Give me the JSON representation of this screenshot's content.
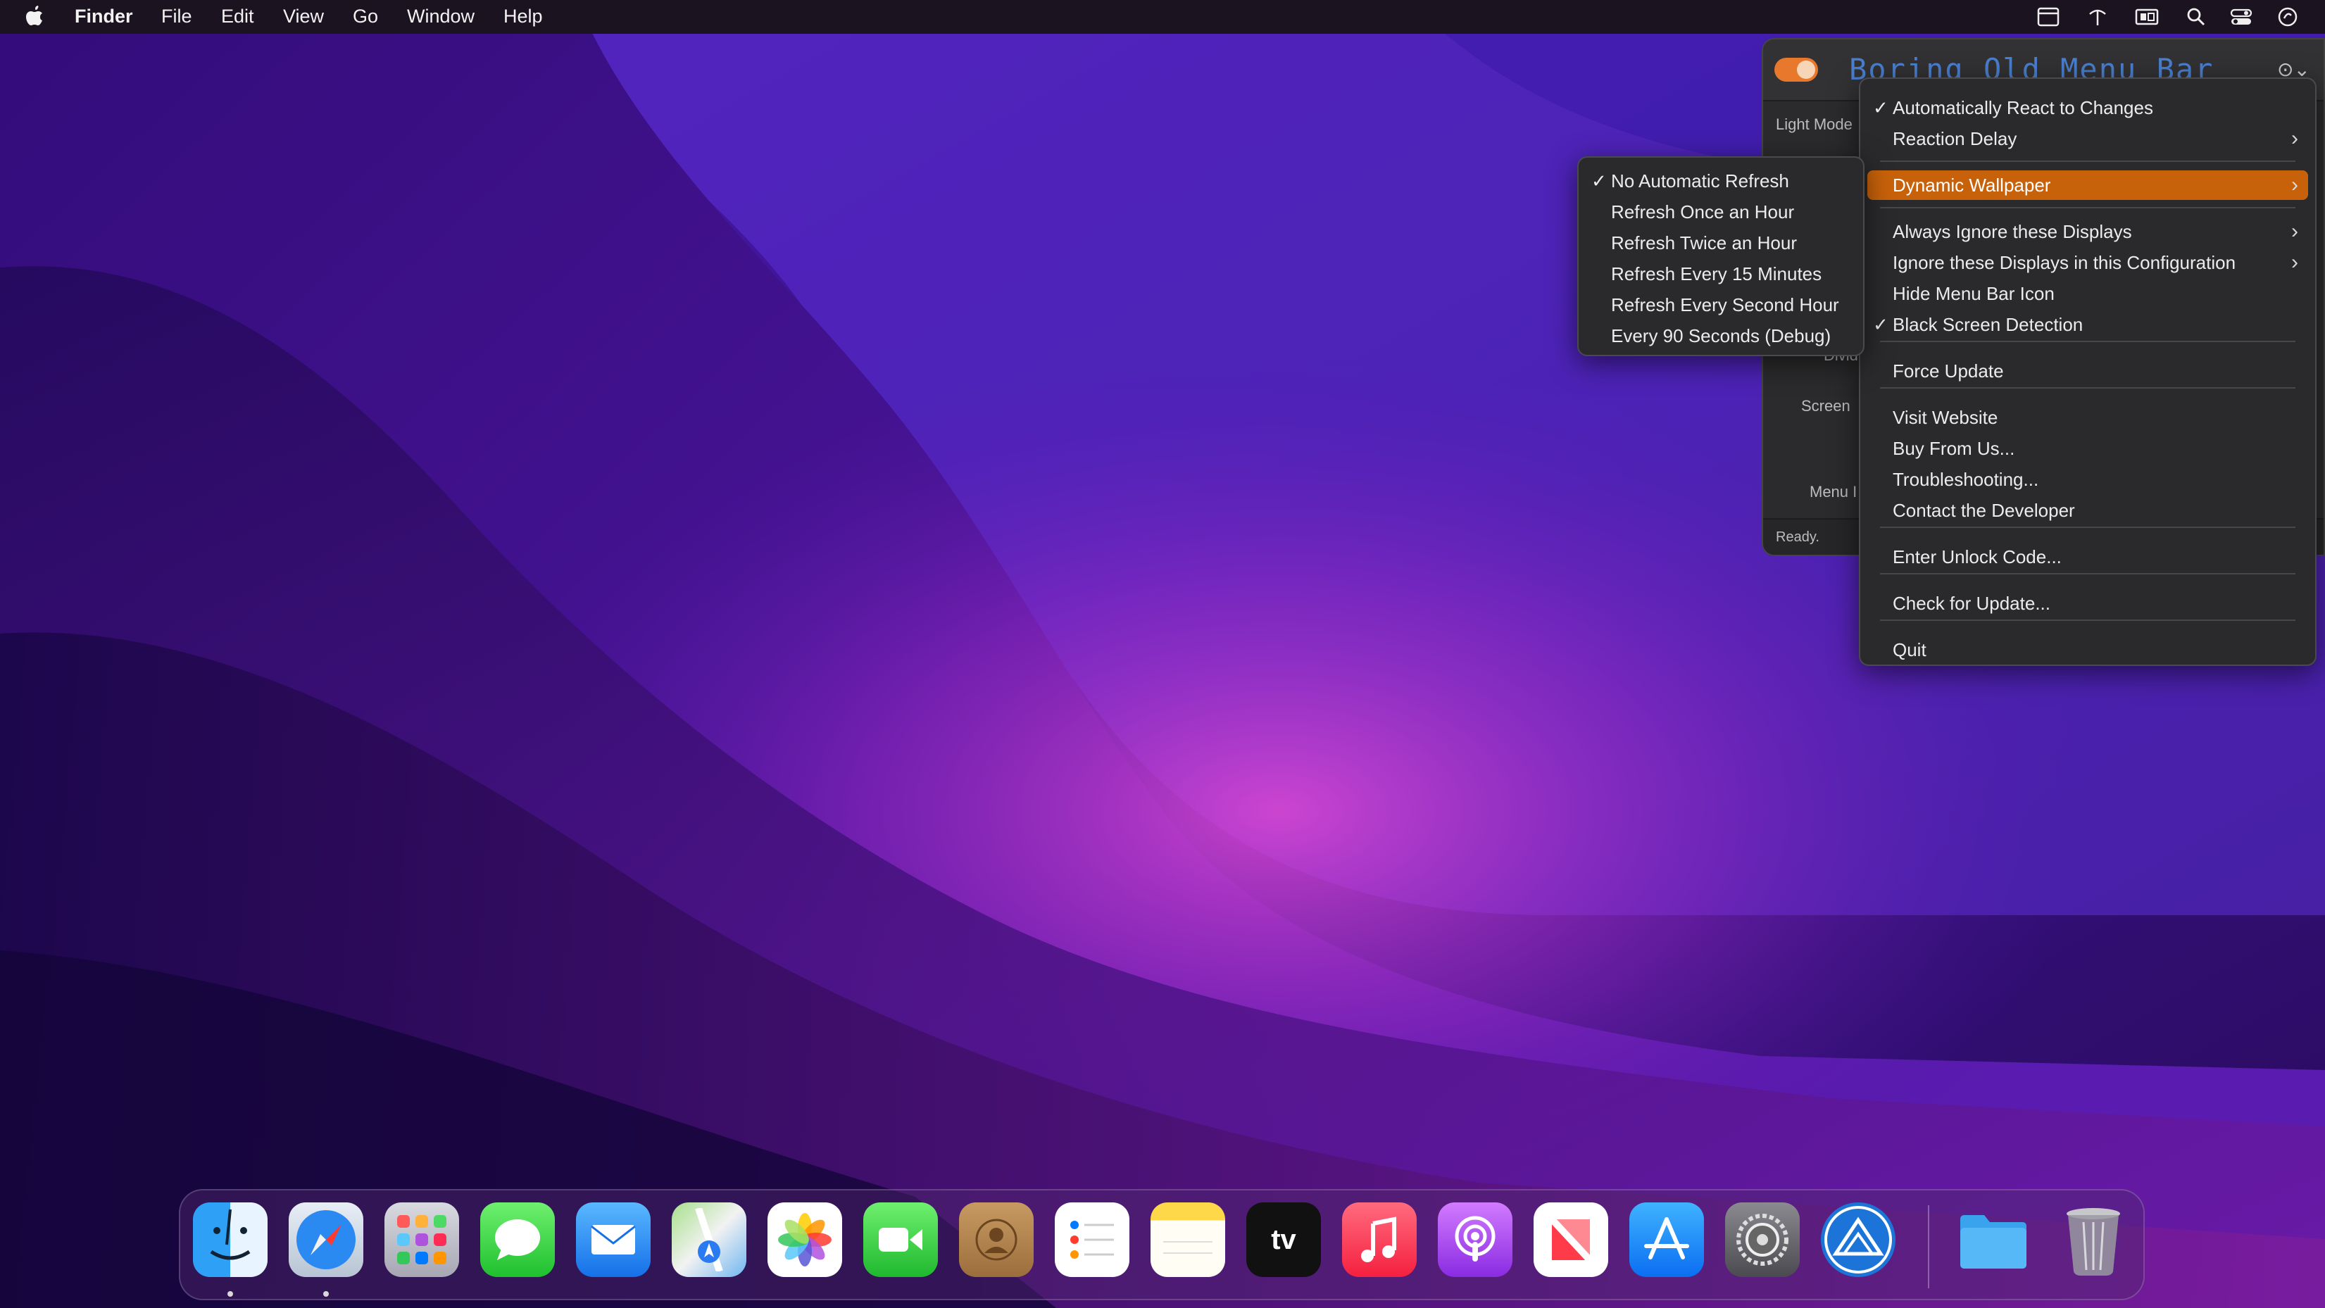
{
  "menubar": {
    "apple_icon": "apple-logo-icon",
    "app_name": "Finder",
    "menus": [
      "File",
      "Edit",
      "View",
      "Go",
      "Window",
      "Help"
    ],
    "status_icons": [
      "calendar-icon",
      "network-icon",
      "display-icon",
      "search-icon",
      "control-center-icon",
      "app-status-icon"
    ]
  },
  "app_window": {
    "title": "Boring Old Menu Bar",
    "labels": {
      "mode": "Light Mode",
      "divider": "Divid",
      "screen": "Screen",
      "menu": "Menu I"
    },
    "status": "Ready.",
    "toggle_on": true,
    "accent_color": "#e8792c"
  },
  "main_menu": {
    "items": [
      {
        "label": "Automatically React to Changes",
        "checked": true
      },
      {
        "label": "Reaction Delay",
        "submenu": true
      },
      {
        "label": "Dynamic Wallpaper",
        "submenu": true,
        "highlighted": true
      },
      {
        "label": "Always Ignore these Displays",
        "submenu": true
      },
      {
        "label": "Ignore these Displays in this Configuration",
        "submenu": true
      },
      {
        "label": "Hide Menu Bar Icon"
      },
      {
        "label": "Black Screen Detection",
        "checked": true
      },
      {
        "label": "Force Update"
      },
      {
        "label": "Visit Website"
      },
      {
        "label": "Buy From Us..."
      },
      {
        "label": "Troubleshooting..."
      },
      {
        "label": "Contact the Developer"
      },
      {
        "label": "Enter Unlock Code..."
      },
      {
        "label": "Check for Update..."
      },
      {
        "label": "Quit"
      }
    ]
  },
  "sub_menu": {
    "items": [
      {
        "label": "No Automatic Refresh",
        "checked": true
      },
      {
        "label": "Refresh Once an Hour"
      },
      {
        "label": "Refresh Twice an Hour"
      },
      {
        "label": "Refresh Every 15 Minutes"
      },
      {
        "label": "Refresh Every Second Hour"
      },
      {
        "label": "Every 90 Seconds (Debug)"
      }
    ]
  },
  "glyphs": {
    "check": "✓",
    "arrow": "›"
  },
  "dock": {
    "apps": [
      "Finder",
      "Safari",
      "Launchpad",
      "Messages",
      "Mail",
      "Maps",
      "Photos",
      "FaceTime",
      "Contacts",
      "Reminders",
      "Notes",
      "TV",
      "Music",
      "Podcasts",
      "News",
      "App Store",
      "System Preferences",
      "Boring Old Menu Bar",
      "Downloads",
      "Trash"
    ],
    "tv_label": "tv"
  },
  "colors": {
    "highlight": "#c8620a",
    "menu_bg": "#2a2a2d",
    "menubar_bg": "#1b1320"
  }
}
